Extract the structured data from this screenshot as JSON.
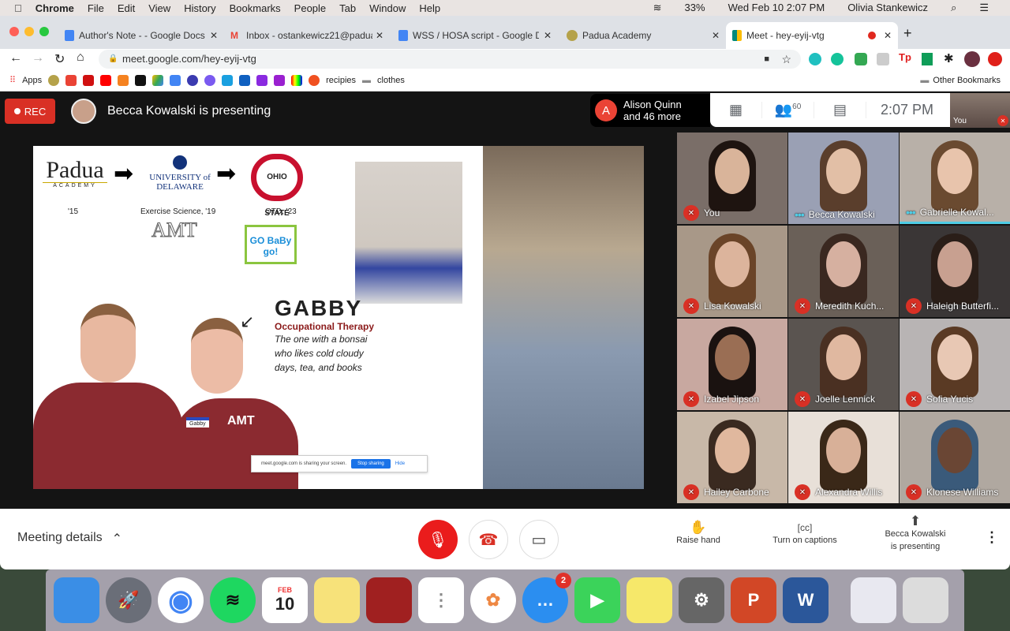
{
  "menubar": {
    "apple": "",
    "items": [
      "Chrome",
      "File",
      "Edit",
      "View",
      "History",
      "Bookmarks",
      "People",
      "Tab",
      "Window",
      "Help"
    ],
    "battery": "33%",
    "datetime": "Wed Feb 10  2:07 PM",
    "user": "Olivia Stankewicz"
  },
  "tabs": [
    {
      "title": "Author's Note - - Google Docs",
      "color": "#4285f4"
    },
    {
      "title": "Inbox - ostankewicz21@paduaac",
      "color": "#ea4335"
    },
    {
      "title": "WSS / HOSA script - Google Do",
      "color": "#4285f4"
    },
    {
      "title": "Padua Academy",
      "color": "#b5a24a"
    },
    {
      "title": "Meet - hey-eyij-vtg",
      "color": "#00897b"
    }
  ],
  "address": {
    "url": "meet.google.com/hey-eyij-vtg"
  },
  "bookmarks": {
    "apps": "Apps",
    "recipies": "recipies",
    "clothes": "clothes",
    "other": "Other Bookmarks"
  },
  "meet": {
    "rec": "REC",
    "presenting": "Becca Kowalski is presenting",
    "alison_initial": "A",
    "alison_line1": "Alison Quinn",
    "alison_line2": "and 46 more",
    "participants_count": "60",
    "time": "2:07 PM",
    "self_label": "You"
  },
  "slide": {
    "padua": "Padua",
    "padua_sub": "ACADEMY",
    "udel": "UNIVERSITY of DELAWARE",
    "osu": "OHIO STATE",
    "year1": "'15",
    "year2": "Exercise Science, '19",
    "year3": "OTD, '23",
    "amt": "AMT",
    "gobaby": "GO BaBy go!",
    "name": "GABBY",
    "field": "Occupational Therapy",
    "desc": "The one with a bonsai who likes cold cloudy days, tea, and books",
    "shirt": "AMT",
    "tag": "Gabby",
    "banner_text": "meet.google.com is sharing your screen.",
    "stop": "Stop sharing",
    "hide": "Hide"
  },
  "participants": [
    {
      "name": "You",
      "muted": true,
      "bg": "#7a6e68",
      "skin": "#d9b49a",
      "hair": "#1e1410"
    },
    {
      "name": "Becca Kowalski",
      "muted": false,
      "bg": "#9aa0b4",
      "skin": "#e2bfa6",
      "hair": "#5a3e2c"
    },
    {
      "name": "Gabrielle Kowal...",
      "muted": false,
      "bg": "#b8b0a8",
      "skin": "#e8c4ac",
      "hair": "#6a4a30"
    },
    {
      "name": "Lisa Kowalski",
      "muted": true,
      "bg": "#a89888",
      "skin": "#dcb49c",
      "hair": "#6a4428"
    },
    {
      "name": "Meredith Kuch...",
      "muted": true,
      "bg": "#6a6058",
      "skin": "#d6b0a0",
      "hair": "#3a2820"
    },
    {
      "name": "Haleigh Butterfi...",
      "muted": true,
      "bg": "#3a3636",
      "skin": "#c8a090",
      "hair": "#2a1e18"
    },
    {
      "name": "Izabel Jipson",
      "muted": true,
      "bg": "#c8a8a0",
      "skin": "#9a6e54",
      "hair": "#1a1210"
    },
    {
      "name": "Joelle Lennick",
      "muted": true,
      "bg": "#5a5450",
      "skin": "#e0b8a0",
      "hair": "#4a3022"
    },
    {
      "name": "Sofia Yucis",
      "muted": true,
      "bg": "#b8b4b4",
      "skin": "#e8c8b4",
      "hair": "#5a3a24"
    },
    {
      "name": "Hailey Carbone",
      "muted": true,
      "bg": "#c8b8a8",
      "skin": "#e0b89e",
      "hair": "#3a2a20"
    },
    {
      "name": "Alexandra Willis",
      "muted": true,
      "bg": "#e8e0d8",
      "skin": "#d8b098",
      "hair": "#3a2818"
    },
    {
      "name": "Klonese Williams",
      "muted": true,
      "bg": "#b0a8a0",
      "skin": "#6a4634",
      "hair": "#3a5a7a"
    }
  ],
  "bottom": {
    "meeting_details": "Meeting details",
    "raise_hand": "Raise hand",
    "captions": "Turn on captions",
    "presenting_line1": "Becca Kowalski",
    "presenting_line2": "is presenting"
  },
  "dock": {
    "apps": [
      {
        "name": "finder",
        "color": "#3a8ee6",
        "glyph": ""
      },
      {
        "name": "launchpad",
        "color": "#6a6e78",
        "glyph": "🚀"
      },
      {
        "name": "chrome",
        "color": "#fff",
        "glyph": "◉"
      },
      {
        "name": "spotify",
        "color": "#1ed760",
        "glyph": "≋"
      },
      {
        "name": "calendar",
        "color": "#fff",
        "glyph": "10"
      },
      {
        "name": "notes",
        "color": "#f7e27a",
        "glyph": ""
      },
      {
        "name": "photo-booth",
        "color": "#a02020",
        "glyph": ""
      },
      {
        "name": "reminders",
        "color": "#fff",
        "glyph": "⋮"
      },
      {
        "name": "photos",
        "color": "#fff",
        "glyph": "✿"
      },
      {
        "name": "messages",
        "color": "#2b8ef0",
        "glyph": "…"
      },
      {
        "name": "facetime",
        "color": "#3bd35a",
        "glyph": "▶"
      },
      {
        "name": "stickies",
        "color": "#f6e86a",
        "glyph": ""
      },
      {
        "name": "system-preferences",
        "color": "#666",
        "glyph": "⚙"
      },
      {
        "name": "powerpoint",
        "color": "#d24726",
        "glyph": "P"
      },
      {
        "name": "word",
        "color": "#2b579a",
        "glyph": "W"
      },
      {
        "name": "screenshot",
        "color": "#e8e8f0",
        "glyph": ""
      },
      {
        "name": "trash",
        "color": "#dcdcdc",
        "glyph": ""
      }
    ],
    "calendar_month": "FEB",
    "calendar_day": "10",
    "messages_badge": "2"
  }
}
